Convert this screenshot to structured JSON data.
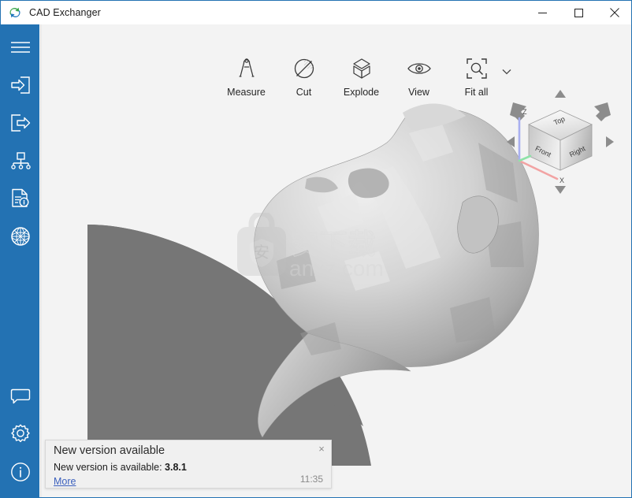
{
  "window": {
    "title": "CAD Exchanger",
    "app_icon": "convert-arrows-icon",
    "controls": {
      "minimize_label": "—",
      "maximize_label": "□",
      "close_label": "✕"
    },
    "accent_color": "#2372b3",
    "viewport_bg": "#f3f3f3"
  },
  "sidebar": {
    "background": "#2372b3",
    "top_items": [
      {
        "name": "menu",
        "label": "Menu",
        "icon": "hamburger-menu-icon"
      },
      {
        "name": "import",
        "label": "Import",
        "icon": "import-arrow-into-box-icon"
      },
      {
        "name": "export",
        "label": "Export",
        "icon": "export-arrow-out-of-box-icon"
      },
      {
        "name": "structure",
        "label": "Model structure",
        "icon": "tree-hierarchy-icon"
      },
      {
        "name": "properties",
        "label": "Properties",
        "icon": "document-info-icon"
      },
      {
        "name": "mesh",
        "label": "Mesh / Globe",
        "icon": "globe-mesh-icon"
      }
    ],
    "bottom_items": [
      {
        "name": "feedback",
        "label": "Feedback",
        "icon": "speech-bubble-icon"
      },
      {
        "name": "settings",
        "label": "Settings",
        "icon": "gear-icon"
      },
      {
        "name": "about",
        "label": "About",
        "icon": "info-circle-icon"
      }
    ]
  },
  "toolbar": {
    "items": [
      {
        "name": "measure",
        "label": "Measure",
        "icon": "compass-divider-icon"
      },
      {
        "name": "cut",
        "label": "Cut",
        "icon": "circle-slash-hatch-icon"
      },
      {
        "name": "explode",
        "label": "Explode",
        "icon": "exploded-cube-icon"
      },
      {
        "name": "view",
        "label": "View",
        "icon": "eye-icon"
      },
      {
        "name": "fit-all",
        "label": "Fit all",
        "icon": "magnifier-in-brackets-icon"
      }
    ],
    "dropdown_icon": "chevron-down-icon"
  },
  "viewcube": {
    "faces": {
      "top": "Top",
      "front": "Front",
      "right": "Right"
    },
    "axes": {
      "z": "Z",
      "x": "X"
    },
    "axis_colors": {
      "x": "#f2a3a3",
      "y": "#8fe3a8",
      "z": "#a9b0f0"
    },
    "arrows": {
      "up": "arrow-up-icon",
      "down": "arrow-down-icon",
      "left": "arrow-left-icon",
      "right": "arrow-right-icon",
      "top_left": "arrow-rotate-top-left-icon",
      "top_right": "arrow-rotate-top-right-icon"
    }
  },
  "scene": {
    "model_name": "scanned-head-mesh",
    "model_color": "#c9c9c9",
    "base_surface_color": "#767676"
  },
  "watermark": {
    "logo_glyph": "安",
    "text_cn": "安下载",
    "text_url": "anxz.com"
  },
  "toast": {
    "title": "New version available",
    "body_prefix": "New version is available: ",
    "body_version": "3.8.1",
    "link_label": "More",
    "time": "11:35",
    "close_label": "×"
  }
}
